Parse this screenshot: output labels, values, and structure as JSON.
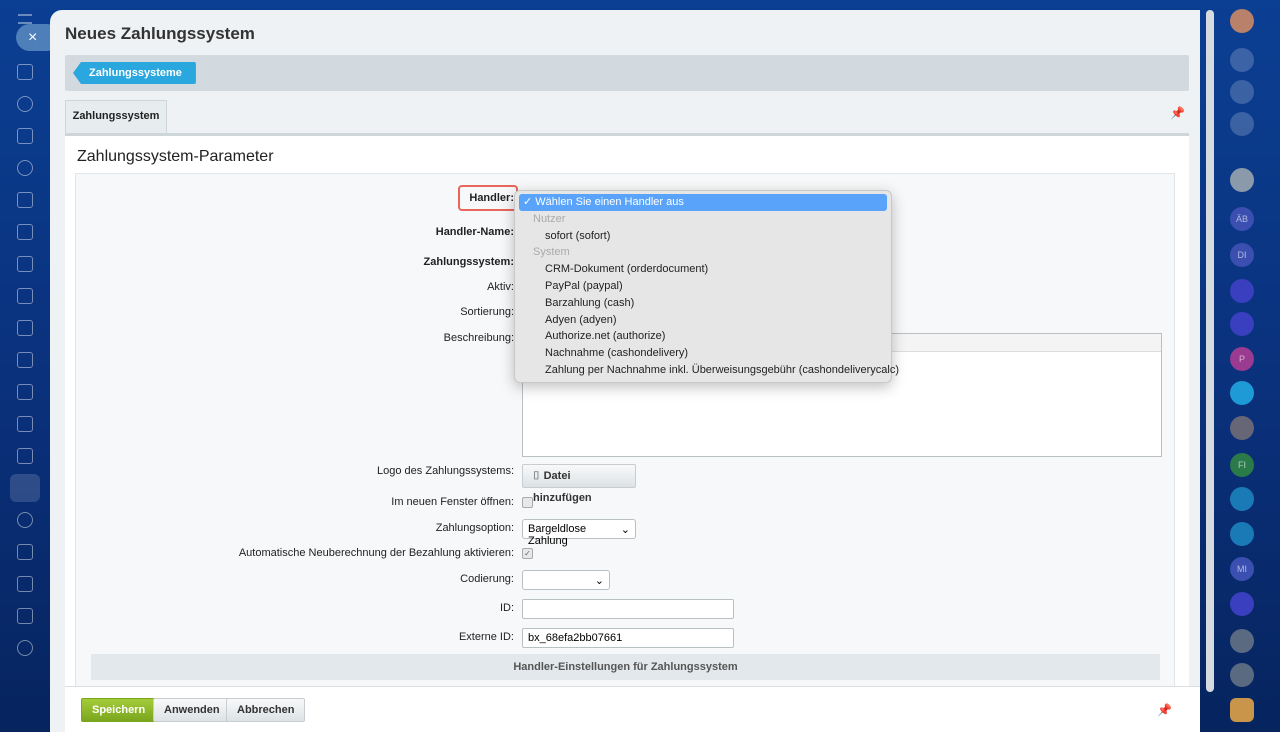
{
  "window": {
    "title": "Neues Zahlungssystem",
    "close_icon": "×"
  },
  "breadcrumb": {
    "label": "Zahlungssysteme"
  },
  "tabs": [
    {
      "label": "Zahlungssystem"
    }
  ],
  "section_title": "Zahlungssystem-Parameter",
  "form": {
    "handler_label": "Handler:",
    "handler_name_label": "Handler-Name:",
    "zahlungssystem_label": "Zahlungssystem:",
    "aktiv_label": "Aktiv:",
    "sortierung_label": "Sortierung:",
    "beschreibung_label": "Beschreibung:",
    "logo_label": "Logo des Zahlungssystems:",
    "logo_button": "Datei hinzufügen",
    "new_window_label": "Im neuen Fenster öffnen:",
    "new_window_checked": false,
    "payment_option_label": "Zahlungsoption:",
    "payment_option_value": "Bargeldlose Zahlung",
    "auto_recalc_label": "Automatische Neuberechnung der Bezahlung aktivieren:",
    "auto_recalc_checked": true,
    "encoding_label": "Codierung:",
    "encoding_value": "",
    "id_label": "ID:",
    "id_value": "",
    "external_id_label": "Externe ID:",
    "external_id_value": "bx_68efa2bb07661",
    "handler_settings_header": "Handler-Einstellungen für Zahlungssystem"
  },
  "handler_dropdown": {
    "selected": "✓ Wählen Sie einen Handler aus",
    "groups": [
      {
        "label": "Nutzer",
        "items": [
          "sofort (sofort)"
        ]
      },
      {
        "label": "System",
        "items": [
          "CRM-Dokument (orderdocument)",
          "PayPal (paypal)",
          "Barzahlung (cash)",
          "Adyen (adyen)",
          "Authorize.net (authorize)",
          "Nachnahme (cashondelivery)",
          "Zahlung per Nachnahme inkl. Überweisungsgebühr (cashondeliverycalc)"
        ]
      }
    ]
  },
  "footer": {
    "save": "Speichern",
    "apply": "Anwenden",
    "cancel": "Abbrechen"
  },
  "right_sidebar": {
    "avatars": [
      "ÄB",
      "DI",
      "P",
      "FI",
      "MI"
    ]
  },
  "colors": {
    "accent": "#2aa7df",
    "save": "#8cb82a",
    "highlight": "#e8665c",
    "dropdown_selected": "#5aa3fb"
  }
}
